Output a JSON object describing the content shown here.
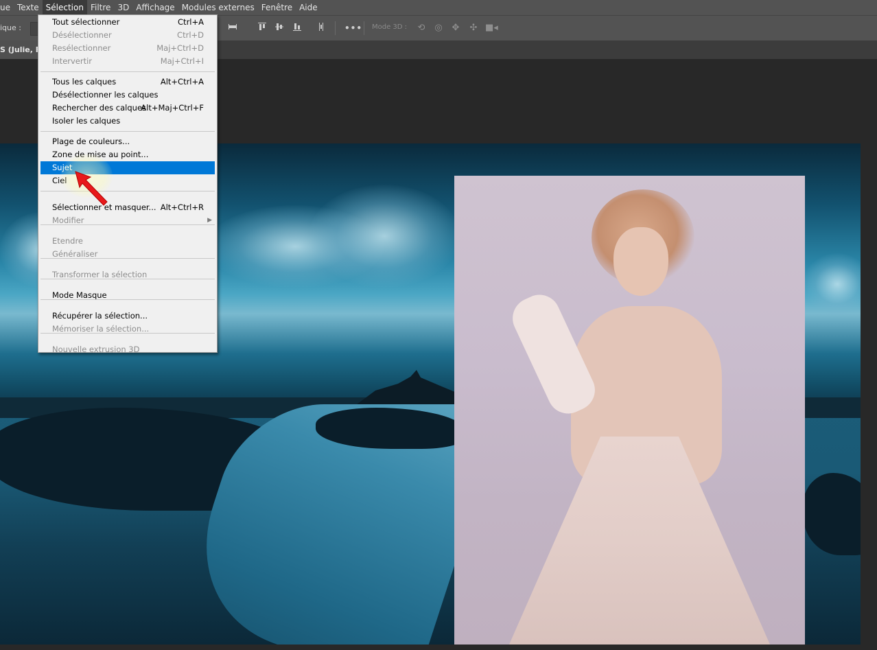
{
  "menubar": {
    "items": [
      {
        "label": "ue",
        "active": false
      },
      {
        "label": "Texte",
        "active": false
      },
      {
        "label": "Sélection",
        "active": true
      },
      {
        "label": "Filtre",
        "active": false
      },
      {
        "label": "3D",
        "active": false
      },
      {
        "label": "Affichage",
        "active": false
      },
      {
        "label": "Modules externes",
        "active": false
      },
      {
        "label": "Fenêtre",
        "active": false
      },
      {
        "label": "Aide",
        "active": false
      }
    ]
  },
  "optionsbar": {
    "partial_label": "ique :",
    "mode3d_label": "Mode 3D :"
  },
  "document": {
    "tab_label": "S (Julie, RV"
  },
  "selection_menu": {
    "groups": [
      [
        {
          "label": "Tout sélectionner",
          "shortcut": "Ctrl+A",
          "enabled": true
        },
        {
          "label": "Désélectionner",
          "shortcut": "Ctrl+D",
          "enabled": false
        },
        {
          "label": "Resélectionner",
          "shortcut": "Maj+Ctrl+D",
          "enabled": false
        },
        {
          "label": "Intervertir",
          "shortcut": "Maj+Ctrl+I",
          "enabled": false
        }
      ],
      [
        {
          "label": "Tous les calques",
          "shortcut": "Alt+Ctrl+A",
          "enabled": true
        },
        {
          "label": "Désélectionner les calques",
          "shortcut": "",
          "enabled": true
        },
        {
          "label": "Rechercher des calques",
          "shortcut": "Alt+Maj+Ctrl+F",
          "enabled": true
        },
        {
          "label": "Isoler les calques",
          "shortcut": "",
          "enabled": true
        }
      ],
      [
        {
          "label": "Plage de couleurs...",
          "shortcut": "",
          "enabled": true
        },
        {
          "label": "Zone de mise au point...",
          "shortcut": "",
          "enabled": true
        },
        {
          "label": "Sujet",
          "shortcut": "",
          "enabled": true,
          "highlighted": true
        },
        {
          "label": "Ciel",
          "shortcut": "",
          "enabled": true
        }
      ],
      [
        {
          "label": "Sélectionner et masquer...",
          "shortcut": "Alt+Ctrl+R",
          "enabled": true
        },
        {
          "label": "Modifier",
          "shortcut": "",
          "enabled": false,
          "submenu": true
        }
      ],
      [
        {
          "label": "Etendre",
          "shortcut": "",
          "enabled": false
        },
        {
          "label": "Généraliser",
          "shortcut": "",
          "enabled": false
        }
      ],
      [
        {
          "label": "Transformer la sélection",
          "shortcut": "",
          "enabled": false
        }
      ],
      [
        {
          "label": "Mode Masque",
          "shortcut": "",
          "enabled": true
        }
      ],
      [
        {
          "label": "Récupérer la sélection...",
          "shortcut": "",
          "enabled": true
        },
        {
          "label": "Mémoriser la sélection...",
          "shortcut": "",
          "enabled": false
        }
      ],
      [
        {
          "label": "Nouvelle extrusion 3D",
          "shortcut": "",
          "enabled": false
        }
      ]
    ]
  },
  "colors": {
    "menu_highlight": "#0078d7",
    "app_chrome": "#535353",
    "workspace": "#282828"
  },
  "icons": [
    "align-top-icon",
    "align-vcenter-icon",
    "align-bottom-icon",
    "distribute-icon",
    "more-options-icon",
    "orbit-3d-icon",
    "roll-3d-icon",
    "pan-3d-icon",
    "slide-3d-icon",
    "camera-3d-icon"
  ]
}
